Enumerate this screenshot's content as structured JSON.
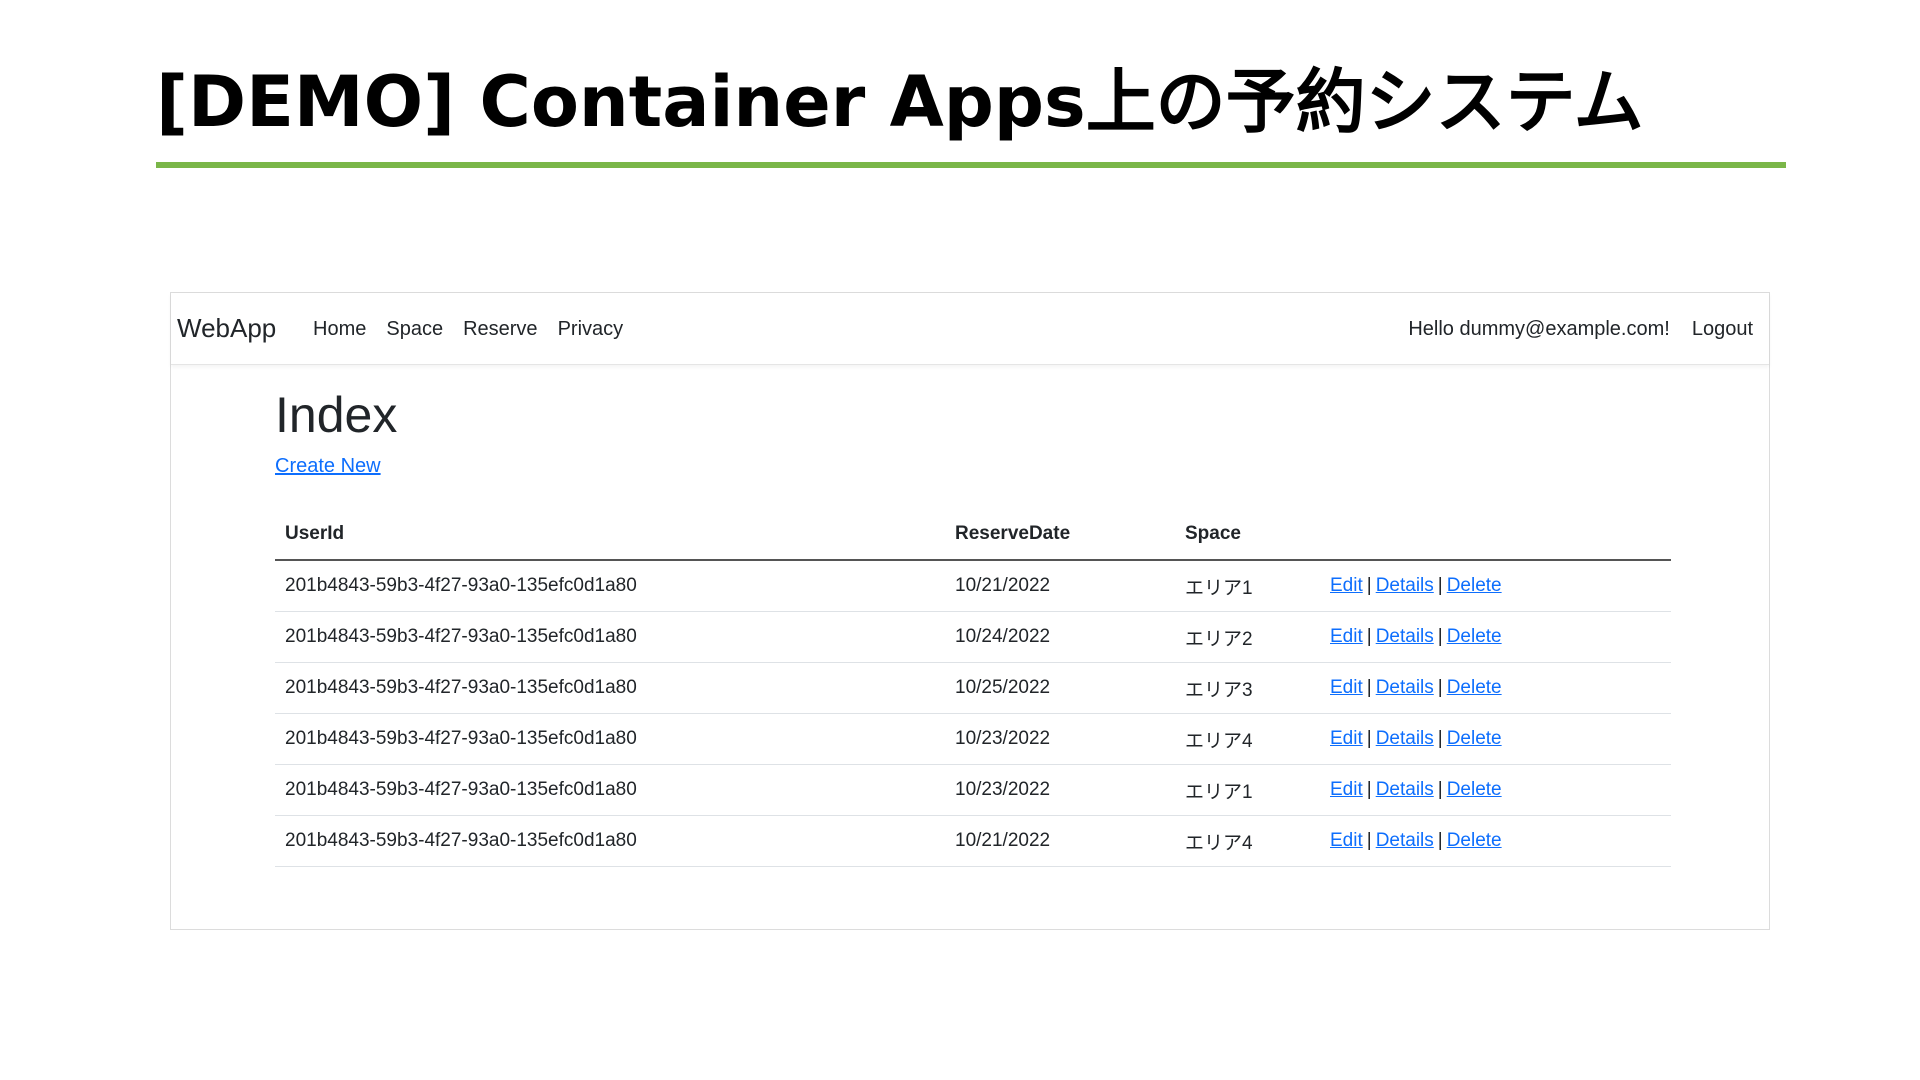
{
  "slide": {
    "title": "[DEMO] Container Apps上の予約システム"
  },
  "colors": {
    "title_rule": "#7ab648",
    "link": "#0d6efd",
    "text": "#212529"
  },
  "navbar": {
    "brand": "WebApp",
    "links": [
      "Home",
      "Space",
      "Reserve",
      "Privacy"
    ],
    "greeting": "Hello dummy@example.com!",
    "logout": "Logout"
  },
  "main": {
    "heading": "Index",
    "create_new": "Create New",
    "table": {
      "headers": [
        "UserId",
        "ReserveDate",
        "Space",
        ""
      ],
      "rows": [
        {
          "user_id": "201b4843-59b3-4f27-93a0-135efc0d1a80",
          "date": "10/21/2022",
          "space": "エリア1"
        },
        {
          "user_id": "201b4843-59b3-4f27-93a0-135efc0d1a80",
          "date": "10/24/2022",
          "space": "エリア2"
        },
        {
          "user_id": "201b4843-59b3-4f27-93a0-135efc0d1a80",
          "date": "10/25/2022",
          "space": "エリア3"
        },
        {
          "user_id": "201b4843-59b3-4f27-93a0-135efc0d1a80",
          "date": "10/23/2022",
          "space": "エリア4"
        },
        {
          "user_id": "201b4843-59b3-4f27-93a0-135efc0d1a80",
          "date": "10/23/2022",
          "space": "エリア1"
        },
        {
          "user_id": "201b4843-59b3-4f27-93a0-135efc0d1a80",
          "date": "10/21/2022",
          "space": "エリア4"
        }
      ],
      "actions": {
        "edit": "Edit",
        "details": "Details",
        "delete": "Delete",
        "separator": "|"
      }
    }
  }
}
